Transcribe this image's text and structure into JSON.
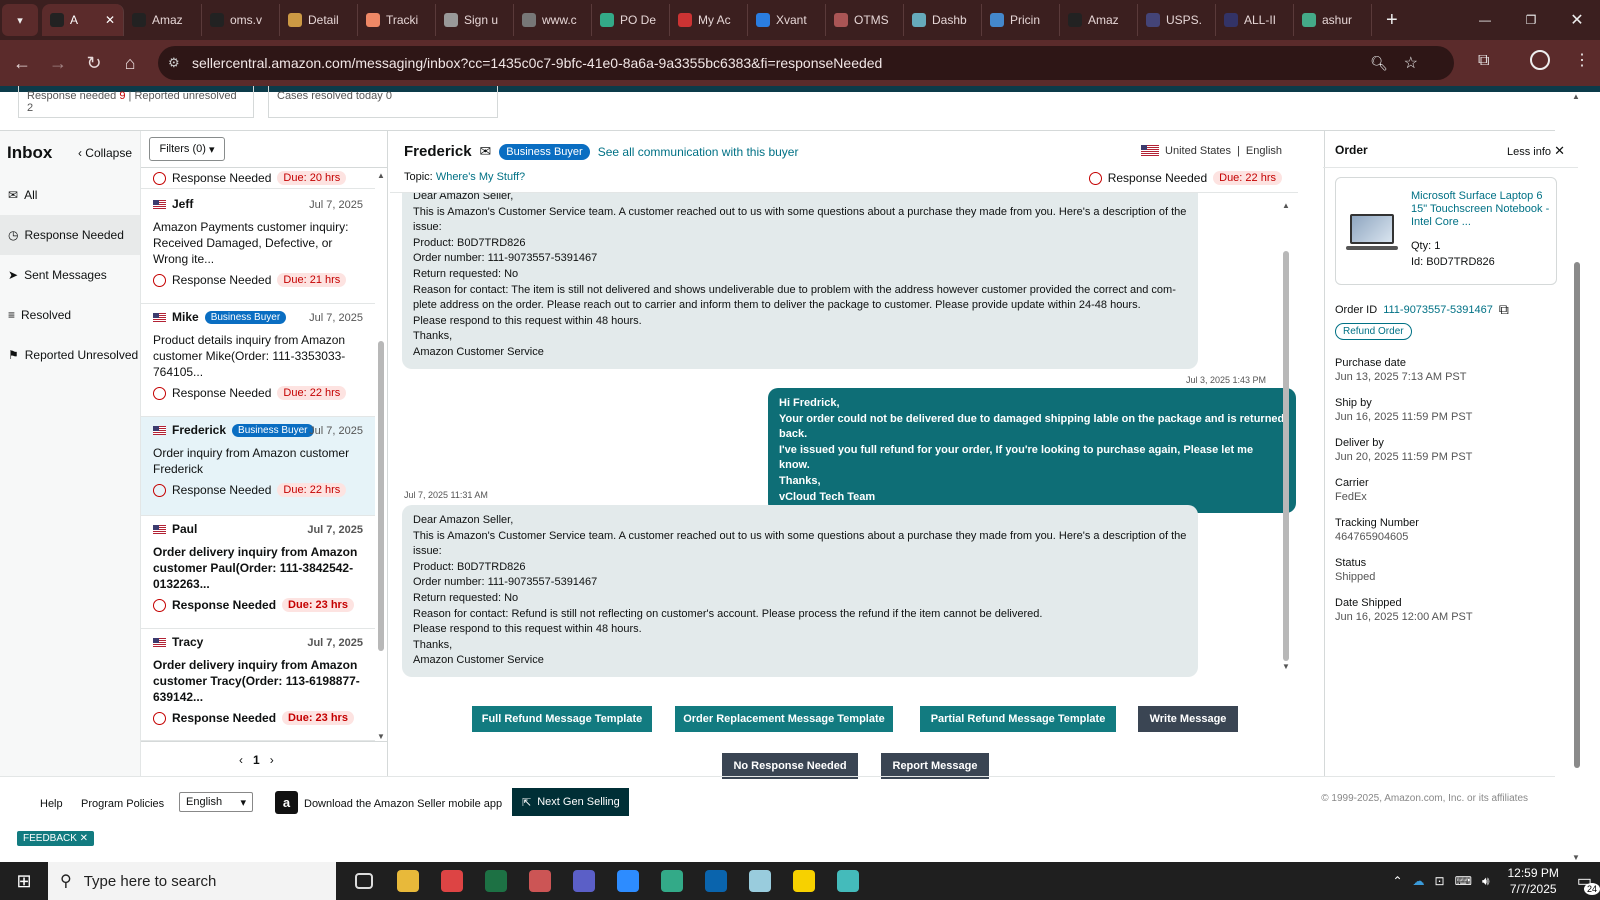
{
  "browser": {
    "tabs": [
      "A",
      "Amaz",
      "oms.v",
      "Detail",
      "Tracki",
      "Sign u",
      "www.c",
      "PO De",
      "My Ac",
      "Xvant",
      "OTMS",
      "Dashb",
      "Pricin",
      "Amaz",
      "USPS.",
      "ALL-II",
      "ashur"
    ],
    "url": "sellercentral.amazon.com/messaging/inbox?cc=1435c0c7-9bfc-41e0-8a6a-9a3355bc6383&fi=responseNeeded"
  },
  "stats": {
    "response_needed_label": "Response needed",
    "response_needed_count": "9",
    "reported_unresolved": "Reported unresolved 2",
    "cases_resolved": "Cases resolved today 0"
  },
  "inbox": {
    "title": "Inbox",
    "collapse": "Collapse",
    "filters": "Filters (0)",
    "nav": [
      "All",
      "Response Needed",
      "Sent Messages",
      "Resolved",
      "Reported Unresolved"
    ]
  },
  "conversations": {
    "top_status": "Response Needed",
    "top_due": "Due: 20 hrs",
    "items": [
      {
        "name": "Jeff",
        "badge": "",
        "date": "Jul 7, 2025",
        "subject": "Amazon Payments customer inquiry: Received Damaged, Defective, or Wrong ite...",
        "status": "Response Needed",
        "due": "Due: 21 hrs"
      },
      {
        "name": "Mike",
        "badge": "Business Buyer",
        "date": "Jul 7, 2025",
        "subject": "Product details inquiry from Amazon customer Mike(Order: 111-3353033-764105...",
        "status": "Response Needed",
        "due": "Due: 22 hrs"
      },
      {
        "name": "Frederick",
        "badge": "Business Buyer",
        "date": "Jul 7, 2025",
        "subject": "Order inquiry from Amazon customer Frederick",
        "status": "Response Needed",
        "due": "Due: 22 hrs"
      },
      {
        "name": "Paul",
        "badge": "",
        "date": "Jul 7, 2025",
        "subject": "Order delivery inquiry from Amazon customer Paul(Order: 111-3842542-0132263...",
        "status": "Response Needed",
        "due": "Due: 23 hrs"
      },
      {
        "name": "Tracy",
        "badge": "",
        "date": "Jul 7, 2025",
        "subject": "Order delivery inquiry from Amazon customer Tracy(Order: 113-6198877-639142...",
        "status": "Response Needed",
        "due": "Due: 23 hrs"
      }
    ],
    "page": "1"
  },
  "thread": {
    "buyer": "Frederick",
    "badge": "Business Buyer",
    "see_all": "See all communication with this buyer",
    "country": "United States",
    "language": "English",
    "topic_label": "Topic:",
    "topic": "Where's My Stuff?",
    "status": "Response Needed",
    "due": "Due: 22 hrs",
    "msg1_lines": [
      "Dear Amazon Seller,",
      "This is Amazon's Customer Service team. A customer reached out to us with some questions about a purchase they made from you. Here's a description of the issue:",
      "Product: B0D7TRD826",
      "Order number: 111-9073557-5391467",
      "Return requested: No",
      "Reason for contact: The item is still not delivered and shows undeliverable due to problem with the address however customer provided the correct and com-plete address on the order. Please reach out to carrier and inform them to deliver the package to customer. Please provide update within 24-48 hours.",
      "Please respond to this request within 48 hours.",
      "Thanks,",
      "Amazon Customer Service"
    ],
    "reply_time": "Jul 3, 2025 1:43 PM",
    "reply_lines": [
      "Hi Fredrick,",
      "Your order could not be delivered due to damaged shipping lable on the package and is returned back.",
      "I've issued you full refund for your order, If you're looking to purchase again, Please let me know.",
      "Thanks,",
      "vCloud Tech Team"
    ],
    "msg2_time": "Jul 7, 2025 11:31 AM",
    "msg2_lines": [
      "Dear Amazon Seller,",
      "This is Amazon's Customer Service team. A customer reached out to us with some questions about a purchase they made from you. Here's a description of the issue:",
      "Product: B0D7TRD826",
      "Order number: 111-9073557-5391467",
      "Return requested: No",
      "Reason for contact: Refund is still not reflecting on customer's account. Please process the refund if the item cannot be delivered.",
      "Please respond to this request within 48 hours.",
      "Thanks,",
      "Amazon Customer Service"
    ],
    "buttons": {
      "full_refund": "Full Refund Message Template",
      "replacement": "Order Replacement Message Template",
      "partial_refund": "Partial Refund Message Template",
      "write": "Write Message",
      "no_response": "No Response Needed",
      "report": "Report Message"
    }
  },
  "order": {
    "title": "Order",
    "less_info": "Less info",
    "product_name": "Microsoft Surface Laptop 6 15\" Touchscreen Notebook - Intel Core ...",
    "qty": "Qty: 1",
    "id": "Id: B0D7TRD826",
    "order_id_label": "Order ID",
    "order_id": "111-9073557-5391467",
    "refund_button": "Refund Order",
    "fields": [
      {
        "label": "Purchase date",
        "value": "Jun 13, 2025 7:13 AM PST"
      },
      {
        "label": "Ship by",
        "value": "Jun 16, 2025 11:59 PM PST"
      },
      {
        "label": "Deliver by",
        "value": "Jun 20, 2025 11:59 PM PST"
      },
      {
        "label": "Carrier",
        "value": "FedEx"
      },
      {
        "label": "Tracking Number",
        "value": "464765904605"
      },
      {
        "label": "Status",
        "value": "Shipped"
      },
      {
        "label": "Date Shipped",
        "value": "Jun 16, 2025 12:00 AM PST"
      }
    ]
  },
  "footer": {
    "help": "Help",
    "policies": "Program Policies",
    "language": "English",
    "app": "Download the Amazon Seller mobile app",
    "next_gen": "Next Gen Selling",
    "copyright": "© 1999-2025, Amazon.com, Inc. or its affiliates",
    "feedback": "FEEDBACK"
  },
  "taskbar": {
    "search_placeholder": "Type here to search",
    "time": "12:59 PM",
    "date": "7/7/2025",
    "notifications": "24"
  },
  "colors": {
    "teal": "#127b80",
    "link": "#007185",
    "due_bg": "#fde3e1",
    "chrome": "#3b1f1f"
  }
}
